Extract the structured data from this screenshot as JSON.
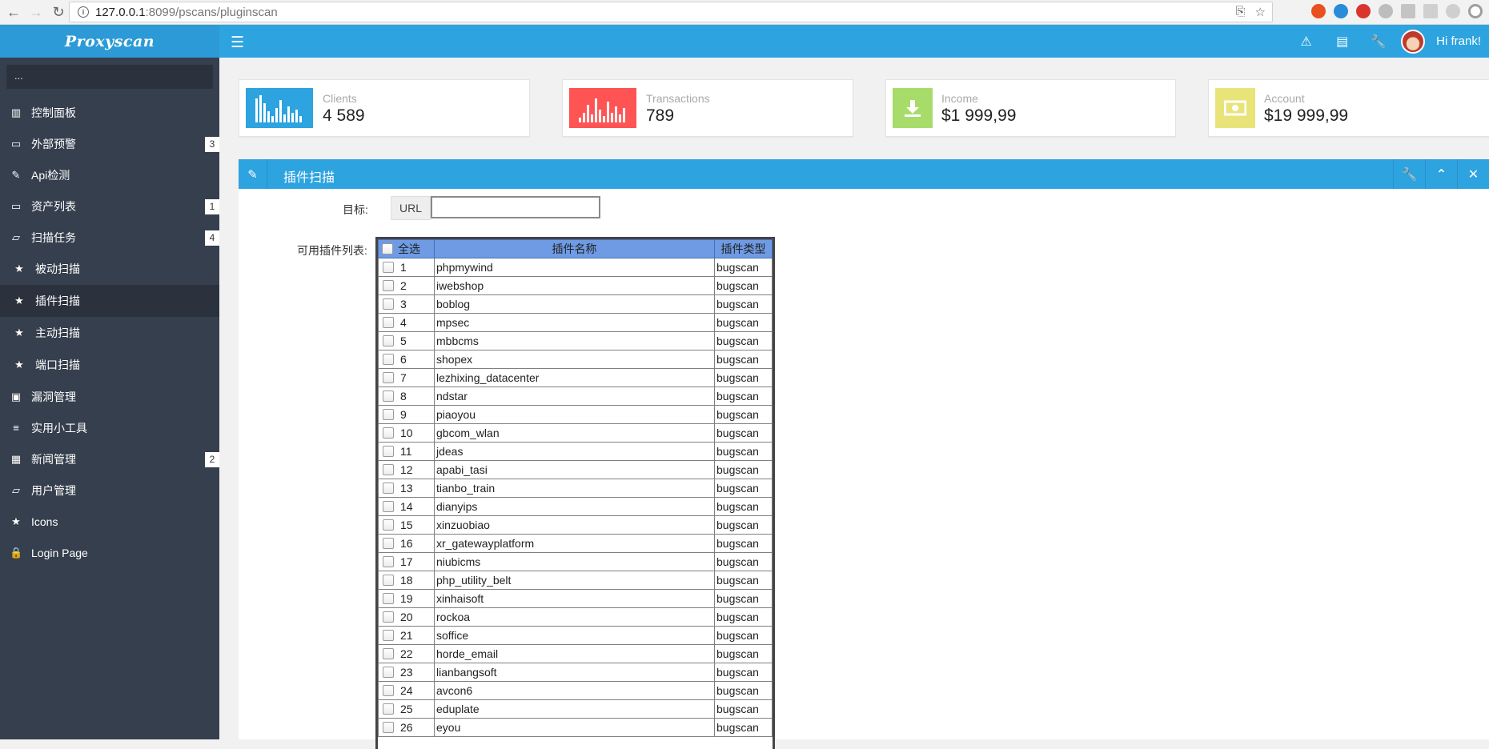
{
  "browser": {
    "url_host": "127.0.0.1",
    "url_rest": ":8099/pscans/pluginscan"
  },
  "sidebar": {
    "brand": "Proxyscan",
    "search_placeholder": "...",
    "items": [
      {
        "label": "控制面板",
        "icon": "chart-icon",
        "glyph": "▥",
        "badge": ""
      },
      {
        "label": "外部预警",
        "icon": "folder-icon",
        "glyph": "▭",
        "badge": "3"
      },
      {
        "label": "Api检测",
        "icon": "edit-icon",
        "glyph": "✎",
        "badge": ""
      },
      {
        "label": "资产列表",
        "icon": "folder-icon",
        "glyph": "▭",
        "badge": "1"
      },
      {
        "label": "扫描任务",
        "icon": "folder-open-icon",
        "glyph": "▱",
        "badge": "4"
      },
      {
        "label": "被动扫描",
        "icon": "star-icon",
        "glyph": "★",
        "badge": "",
        "sub": true
      },
      {
        "label": "插件扫描",
        "icon": "star-icon",
        "glyph": "★",
        "badge": "",
        "sub": true,
        "active": true
      },
      {
        "label": "主动扫描",
        "icon": "star-icon",
        "glyph": "★",
        "badge": "",
        "sub": true
      },
      {
        "label": "端口扫描",
        "icon": "star-icon",
        "glyph": "★",
        "badge": "",
        "sub": true
      },
      {
        "label": "漏洞管理",
        "icon": "picture-icon",
        "glyph": "▣",
        "badge": ""
      },
      {
        "label": "实用小工具",
        "icon": "list-icon",
        "glyph": "≡",
        "badge": ""
      },
      {
        "label": "新闻管理",
        "icon": "calendar-icon",
        "glyph": "▦",
        "badge": "2"
      },
      {
        "label": "用户管理",
        "icon": "folder-open-icon",
        "glyph": "▱",
        "badge": ""
      },
      {
        "label": "Icons",
        "icon": "star-icon",
        "glyph": "★",
        "badge": ""
      },
      {
        "label": "Login Page",
        "icon": "lock-icon",
        "glyph": "🔒",
        "badge": ""
      }
    ]
  },
  "header": {
    "greeting": "Hi frank!"
  },
  "stats": [
    {
      "label": "Clients",
      "value": "4 589",
      "color": "#2da3e0",
      "icon": "bar-chart-icon"
    },
    {
      "label": "Transactions",
      "value": "789",
      "color": "#ff5454",
      "icon": "bar-chart-icon"
    },
    {
      "label": "Income",
      "value": "$1 999,99",
      "color": "#a8dc6a",
      "icon": "download-icon"
    },
    {
      "label": "Account",
      "value": "$19 999,99",
      "color": "#e8e47a",
      "icon": "money-icon"
    }
  ],
  "panel": {
    "title": "插件扫描",
    "target_label": "目标:",
    "url_addon": "URL",
    "url_value": "",
    "plugin_list_label": "可用插件列表:",
    "table": {
      "headers": [
        "全选",
        "插件名称",
        "插件类型"
      ],
      "rows": [
        {
          "num": "1",
          "name": "phpmywind",
          "type": "bugscan"
        },
        {
          "num": "2",
          "name": "iwebshop",
          "type": "bugscan"
        },
        {
          "num": "3",
          "name": "boblog",
          "type": "bugscan"
        },
        {
          "num": "4",
          "name": "mpsec",
          "type": "bugscan"
        },
        {
          "num": "5",
          "name": "mbbcms",
          "type": "bugscan"
        },
        {
          "num": "6",
          "name": "shopex",
          "type": "bugscan"
        },
        {
          "num": "7",
          "name": "lezhixing_datacenter",
          "type": "bugscan"
        },
        {
          "num": "8",
          "name": "ndstar",
          "type": "bugscan"
        },
        {
          "num": "9",
          "name": "piaoyou",
          "type": "bugscan"
        },
        {
          "num": "10",
          "name": "gbcom_wlan",
          "type": "bugscan"
        },
        {
          "num": "11",
          "name": "jdeas",
          "type": "bugscan"
        },
        {
          "num": "12",
          "name": "apabi_tasi",
          "type": "bugscan"
        },
        {
          "num": "13",
          "name": "tianbo_train",
          "type": "bugscan"
        },
        {
          "num": "14",
          "name": "dianyips",
          "type": "bugscan"
        },
        {
          "num": "15",
          "name": "xinzuobiao",
          "type": "bugscan"
        },
        {
          "num": "16",
          "name": "xr_gatewayplatform",
          "type": "bugscan"
        },
        {
          "num": "17",
          "name": "niubicms",
          "type": "bugscan"
        },
        {
          "num": "18",
          "name": "php_utility_belt",
          "type": "bugscan"
        },
        {
          "num": "19",
          "name": "xinhaisoft",
          "type": "bugscan"
        },
        {
          "num": "20",
          "name": "rockoa",
          "type": "bugscan"
        },
        {
          "num": "21",
          "name": "soffice",
          "type": "bugscan"
        },
        {
          "num": "22",
          "name": "horde_email",
          "type": "bugscan"
        },
        {
          "num": "23",
          "name": "lianbangsoft",
          "type": "bugscan"
        },
        {
          "num": "24",
          "name": "avcon6",
          "type": "bugscan"
        },
        {
          "num": "25",
          "name": "eduplate",
          "type": "bugscan"
        },
        {
          "num": "26",
          "name": "eyou",
          "type": "bugscan"
        }
      ]
    }
  }
}
